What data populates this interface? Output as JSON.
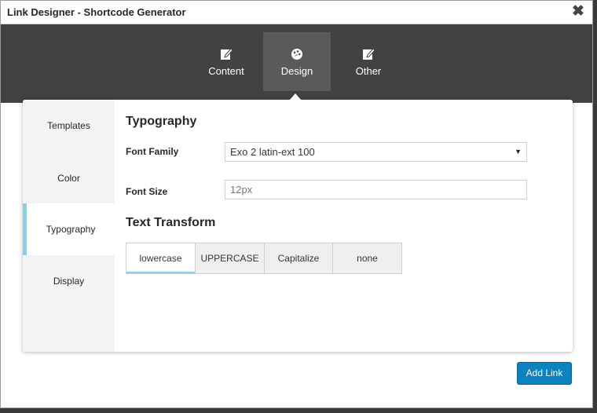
{
  "window": {
    "title": "Link Designer - Shortcode Generator",
    "close_icon": "✖"
  },
  "main_tabs": [
    {
      "label": "Content",
      "icon": "edit-icon",
      "active": false
    },
    {
      "label": "Design",
      "icon": "palette-icon",
      "active": true
    },
    {
      "label": "Other",
      "icon": "edit-icon",
      "active": false
    }
  ],
  "side_tabs": [
    {
      "label": "Templates",
      "active": false
    },
    {
      "label": "Color",
      "active": false
    },
    {
      "label": "Typography",
      "active": true
    },
    {
      "label": "Display",
      "active": false
    }
  ],
  "typography": {
    "heading": "Typography",
    "font_family_label": "Font Family",
    "font_family_value": "Exo 2 latin-ext 100",
    "font_size_label": "Font Size",
    "font_size_placeholder": "12px",
    "text_transform_heading": "Text Transform",
    "transform_options": [
      {
        "label": "lowercase",
        "active": true
      },
      {
        "label": "UPPERCASE",
        "active": false
      },
      {
        "label": "Capitalize",
        "active": false
      },
      {
        "label": "none",
        "active": false
      }
    ]
  },
  "add_button_label": "Add Link",
  "colors": {
    "accent": "#7fd3ef",
    "primary_button": "#0c82c0",
    "header_bg": "#424242"
  }
}
